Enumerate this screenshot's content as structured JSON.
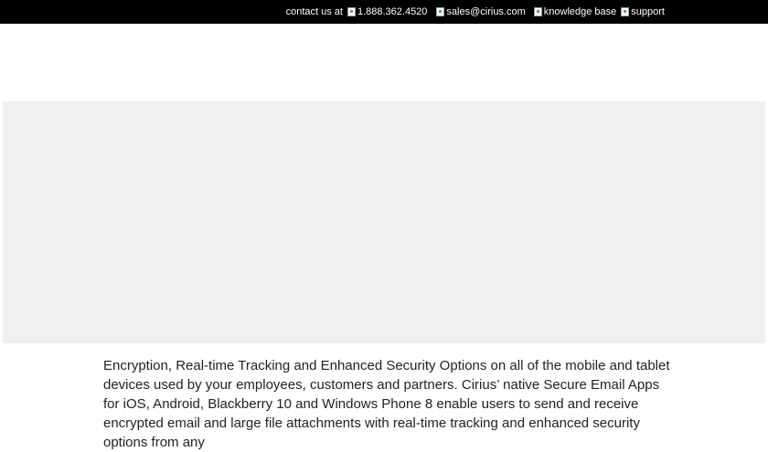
{
  "topbar": {
    "contact_label": "contact us at",
    "phone": "1.888.362.4520",
    "email": "sales@cirius.com",
    "knowledge_base": "knowledge base",
    "support": "support"
  },
  "content": {
    "intro_text": "Encryption, Real-time Tracking and Enhanced Security Options on all of the mobile and tablet devices used by your employees, customers and partners. Cirius’ native Secure Email Apps for iOS, Android, Blackberry 10 and Windows Phone 8 enable users to send and receive encrypted email and large file attachments with real-time tracking and enhanced security options from any"
  },
  "colors": {
    "topbar_bg": "#000000",
    "banner_bg": "#f0f0f0",
    "text": "#222222"
  }
}
